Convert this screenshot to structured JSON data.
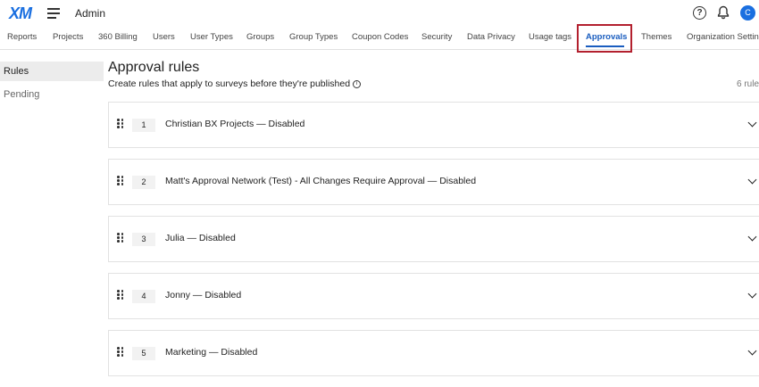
{
  "header": {
    "logo": "XM",
    "app_title": "Admin",
    "help": "?",
    "avatar_initial": "C"
  },
  "tabs": [
    {
      "label": "Reports"
    },
    {
      "label": "Projects"
    },
    {
      "label": "360 Billing"
    },
    {
      "label": "Users"
    },
    {
      "label": "User Types"
    },
    {
      "label": "Groups"
    },
    {
      "label": "Group Types"
    },
    {
      "label": "Coupon Codes"
    },
    {
      "label": "Security"
    },
    {
      "label": "Data Privacy"
    },
    {
      "label": "Usage tags"
    },
    {
      "label": "Approvals",
      "active": true
    },
    {
      "label": "Themes"
    },
    {
      "label": "Organization Settings"
    }
  ],
  "sidebar": {
    "items": [
      {
        "label": "Rules",
        "active": true
      },
      {
        "label": "Pending"
      }
    ]
  },
  "main": {
    "title": "Approval rules",
    "subtitle": "Create rules that apply to surveys before they're published",
    "info": "i",
    "rule_count": "6 rule"
  },
  "rules": [
    {
      "number": "1",
      "name": "Christian BX Projects — Disabled"
    },
    {
      "number": "2",
      "name": "Matt's Approval Network (Test) - All Changes Require Approval — Disabled"
    },
    {
      "number": "3",
      "name": "Julia — Disabled"
    },
    {
      "number": "4",
      "name": "Jonny — Disabled"
    },
    {
      "number": "5",
      "name": "Marketing — Disabled"
    }
  ],
  "colors": {
    "accent": "#1a5dbf",
    "brand": "#1a6fe0",
    "highlight": "#b3202e"
  }
}
